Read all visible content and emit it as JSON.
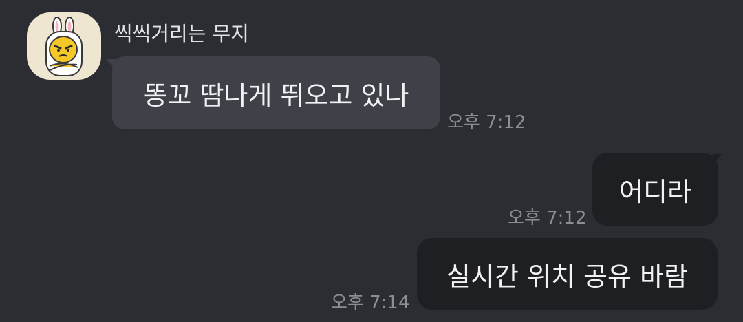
{
  "chat": {
    "sender_name": "씩씩거리는 무지",
    "avatar_icon": "muzi-character-icon",
    "messages": [
      {
        "direction": "incoming",
        "text": "똥꼬 땀나게 뛰오고 있나",
        "time": "오후 7:12"
      },
      {
        "direction": "outgoing",
        "text": "어디라",
        "time": "오후 7:12"
      },
      {
        "direction": "outgoing",
        "text": "실시간 위치 공유 바람",
        "time": "오후 7:14"
      }
    ]
  },
  "colors": {
    "background": "#2b2d33",
    "incoming_bubble": "#3f4148",
    "outgoing_bubble": "#1e1f23",
    "text": "#f2f2f4",
    "timestamp": "#8d8e94",
    "avatar_background": "#efe6d2"
  }
}
